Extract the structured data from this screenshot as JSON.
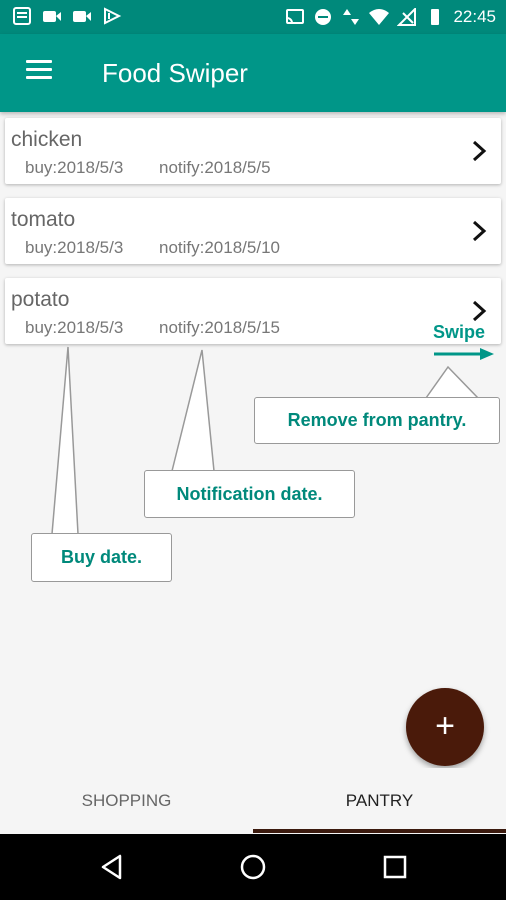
{
  "status_bar": {
    "time": "22:45",
    "left_icons": [
      "app-icon",
      "video-icon",
      "video-icon",
      "app-icon"
    ],
    "right_icons": [
      "cast-icon",
      "do-not-disturb-icon",
      "data-icon",
      "wifi-icon",
      "no-signal-icon",
      "battery-icon"
    ]
  },
  "app_bar": {
    "title": "Food Swiper"
  },
  "items": [
    {
      "name": "chicken",
      "buy": "buy:2018/5/3",
      "notify": "notify:2018/5/5"
    },
    {
      "name": "tomato",
      "buy": "buy:2018/5/3",
      "notify": "notify:2018/5/10"
    },
    {
      "name": "potato",
      "buy": "buy:2018/5/3",
      "notify": "notify:2018/5/15"
    }
  ],
  "tutorial": {
    "swipe": "Swipe",
    "remove": "Remove from pantry.",
    "notification": "Notification date.",
    "buy": "Buy date."
  },
  "fab": {
    "label": "+"
  },
  "tabs": [
    {
      "label": "SHOPPING",
      "selected": false
    },
    {
      "label": "PANTRY",
      "selected": true
    }
  ],
  "colors": {
    "primary": "#009688",
    "status_bar": "#00897b",
    "accent": "#4a1a0a"
  }
}
